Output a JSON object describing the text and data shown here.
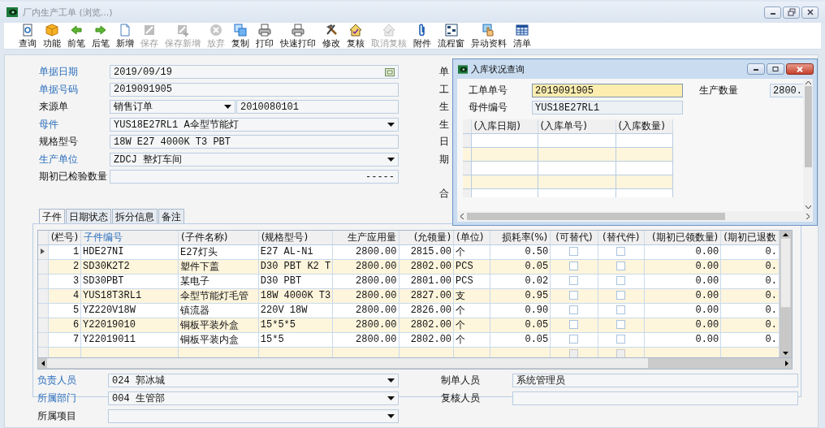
{
  "window": {
    "title": "厂内生产工单 (浏览...)"
  },
  "toolbar": [
    {
      "label": "查询",
      "disabled": false
    },
    {
      "label": "功能",
      "disabled": false
    },
    {
      "label": "前笔",
      "disabled": false
    },
    {
      "label": "后笔",
      "disabled": false
    },
    {
      "label": "新增",
      "disabled": false
    },
    {
      "label": "保存",
      "disabled": true
    },
    {
      "label": "保存新增",
      "disabled": true
    },
    {
      "label": "放弃",
      "disabled": true
    },
    {
      "label": "复制",
      "disabled": false
    },
    {
      "label": "打印",
      "disabled": false
    },
    {
      "label": "快速打印",
      "disabled": false
    },
    {
      "label": "修改",
      "disabled": false
    },
    {
      "label": "复核",
      "disabled": false
    },
    {
      "label": "取消复核",
      "disabled": true
    },
    {
      "label": "附件",
      "disabled": false
    },
    {
      "label": "流程窗",
      "disabled": false
    },
    {
      "label": "异动资料",
      "disabled": false
    },
    {
      "label": "清单",
      "disabled": false
    }
  ],
  "form": [
    {
      "label": "单据日期",
      "highlighted": true,
      "kind": "date",
      "value": "2019/09/19"
    },
    {
      "label": "单据号码",
      "highlighted": true,
      "kind": "text",
      "value": "2019091905"
    },
    {
      "label": "来源单",
      "highlighted": false,
      "kind": "combo",
      "value": "销售订单",
      "extra": "2010080101"
    },
    {
      "label": "母件",
      "highlighted": true,
      "kind": "dropdown",
      "value": "YUS18E27RL1 A伞型节能灯"
    },
    {
      "label": "规格型号",
      "highlighted": false,
      "kind": "text",
      "value": "18W E27 4000K T3 PBT"
    },
    {
      "label": "生产单位",
      "highlighted": true,
      "kind": "dropdown",
      "value": "ZDCJ 整灯车间"
    },
    {
      "label": "期初已检验数量",
      "highlighted": false,
      "kind": "number",
      "value": "-----"
    }
  ],
  "right_labels": [
    "单",
    "工",
    "生",
    "生",
    "日",
    "期",
    "合"
  ],
  "tabs": [
    {
      "label": "子件",
      "selected": true
    },
    {
      "label": "日期状态",
      "selected": false
    },
    {
      "label": "拆分信息",
      "selected": false
    },
    {
      "label": "备注",
      "selected": false
    }
  ],
  "table": {
    "columns": [
      {
        "label": "(栏号)",
        "highlighted": false
      },
      {
        "label": "子件编号",
        "highlighted": true
      },
      {
        "label": "(子件名称)",
        "highlighted": false
      },
      {
        "label": "(规格型号)",
        "highlighted": false
      },
      {
        "label": "生产应用量",
        "highlighted": false
      },
      {
        "label": "(允领量)",
        "highlighted": false
      },
      {
        "label": "(单位)",
        "highlighted": false
      },
      {
        "label": "损耗率(%)",
        "highlighted": false
      },
      {
        "label": "(可替代)",
        "highlighted": false
      },
      {
        "label": "(替代件)",
        "highlighted": false
      },
      {
        "label": "(期初已领数量)",
        "highlighted": false
      },
      {
        "label": "(期初已退数",
        "highlighted": false
      }
    ],
    "rows": [
      {
        "selected": true,
        "no": "1",
        "code": "HDE27NI",
        "name": "E27灯头",
        "spec": "E27 AL-Ni",
        "usage": "2800.00",
        "allowed": "2815.00",
        "unit": "个",
        "loss": "0.50",
        "substitutable": false,
        "substitute": false,
        "issued": "0.00",
        "returned": "0."
      },
      {
        "selected": false,
        "no": "2",
        "code": "SD30K2T2",
        "name": "塑件下盖",
        "spec": "D30 PBT K2 T",
        "usage": "2800.00",
        "allowed": "2802.00",
        "unit": "PCS",
        "loss": "0.05",
        "substitutable": false,
        "substitute": false,
        "issued": "0.00",
        "returned": "0."
      },
      {
        "selected": false,
        "no": "3",
        "code": "SD30PBT",
        "name": "某电子",
        "spec": "D30 PBT",
        "usage": "2800.00",
        "allowed": "2801.00",
        "unit": "PCS",
        "loss": "0.02",
        "substitutable": false,
        "substitute": false,
        "issued": "0.00",
        "returned": "0."
      },
      {
        "selected": false,
        "no": "4",
        "code": "YUS18T3RL1",
        "name": "伞型节能灯毛管",
        "spec": "18W 4000K T3",
        "usage": "2800.00",
        "allowed": "2827.00",
        "unit": "支",
        "loss": "0.95",
        "substitutable": false,
        "substitute": false,
        "issued": "0.00",
        "returned": "0."
      },
      {
        "selected": false,
        "no": "5",
        "code": "YZ220V18W",
        "name": "镇流器",
        "spec": "220V 18W",
        "usage": "2800.00",
        "allowed": "2826.00",
        "unit": "个",
        "loss": "0.90",
        "substitutable": false,
        "substitute": false,
        "issued": "0.00",
        "returned": "0."
      },
      {
        "selected": false,
        "no": "6",
        "code": "Y22019010",
        "name": "铜板平装外盒",
        "spec": "15*5*5",
        "usage": "2800.00",
        "allowed": "2802.00",
        "unit": "个",
        "loss": "0.05",
        "substitutable": false,
        "substitute": false,
        "issued": "0.00",
        "returned": "0."
      },
      {
        "selected": false,
        "no": "7",
        "code": "Y22019011",
        "name": "铜板平装内盒",
        "spec": "15*5",
        "usage": "2800.00",
        "allowed": "2802.00",
        "unit": "个",
        "loss": "0.05",
        "substitutable": false,
        "substitute": false,
        "issued": "0.00",
        "returned": "0."
      }
    ]
  },
  "blank_row": {
    "disabled": true,
    "substitutable": false,
    "substitute": false
  },
  "footer_left": [
    {
      "label": "负责人员",
      "highlighted": true,
      "value": "024 郭冰城"
    },
    {
      "label": "所属部门",
      "highlighted": true,
      "value": "004 生管部"
    },
    {
      "label": "所属项目",
      "highlighted": false
    }
  ],
  "footer_right": [
    {
      "label": "制单人员",
      "value": "系统管理员"
    },
    {
      "label": "复核人员"
    }
  ],
  "popup": {
    "title": "入库状况查询",
    "order_label": "工单单号",
    "order_value": "2019091905",
    "qty_label": "生产数量",
    "qty_value": "2800.",
    "parent_label": "母件编号",
    "parent_value": "YUS18E27RL1",
    "columns": [
      "(入库日期)",
      "(入库单号)",
      "(入库数量)"
    ]
  }
}
